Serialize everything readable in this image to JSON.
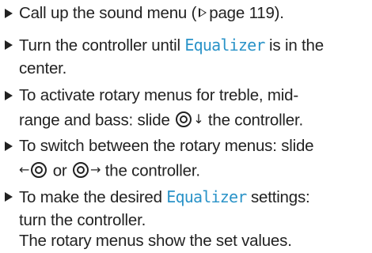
{
  "steps": [
    {
      "lines": [
        {
          "a": "Call up the sound menu (",
          "b": "page 119)."
        }
      ]
    },
    {
      "lines": [
        {
          "a": "Turn the controller until ",
          "kw": "Equalizer",
          "b": " is in the"
        },
        {
          "a": "center."
        }
      ]
    },
    {
      "lines": [
        {
          "a": "To activate rotary menus for treble, mid-"
        },
        {
          "a": "range and bass: slide ",
          "arrow": "↓",
          "b": " the controller."
        }
      ]
    },
    {
      "lines": [
        {
          "a": "To switch between the rotary menus: slide"
        },
        {
          "arrow_left": "←",
          "mid": " or ",
          "arrow_right": "→",
          "b": " the controller."
        }
      ]
    },
    {
      "lines": [
        {
          "a": "To make the desired ",
          "kw": "Equalizer",
          "b": " settings:"
        },
        {
          "a": "turn the controller."
        },
        {
          "a": "The rotary menus show the set values."
        }
      ]
    }
  ],
  "colors": {
    "text": "#222222",
    "keyword": "#2a93c8"
  },
  "icons": {
    "bullet": "triangle-right-icon",
    "page_ref": "outline-triangle-right-icon",
    "controller": "controller-knob-icon"
  }
}
